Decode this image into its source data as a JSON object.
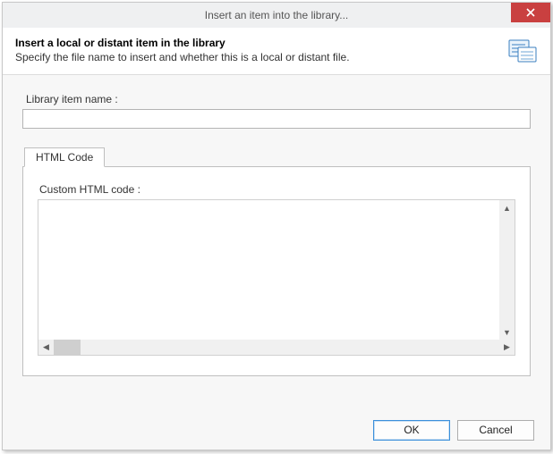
{
  "titlebar": {
    "title": "Insert an item into the library..."
  },
  "header": {
    "title": "Insert a local or distant item in the library",
    "subtitle": "Specify the file name to insert and whether this is a local or distant file."
  },
  "fields": {
    "library_item_label": "Library item name :",
    "library_item_value": ""
  },
  "tabs": {
    "html_code": "HTML Code"
  },
  "editor": {
    "custom_label": "Custom HTML code :",
    "value": ""
  },
  "buttons": {
    "ok": "OK",
    "cancel": "Cancel"
  },
  "icons": {
    "close": "close-icon",
    "library": "library-icon"
  }
}
